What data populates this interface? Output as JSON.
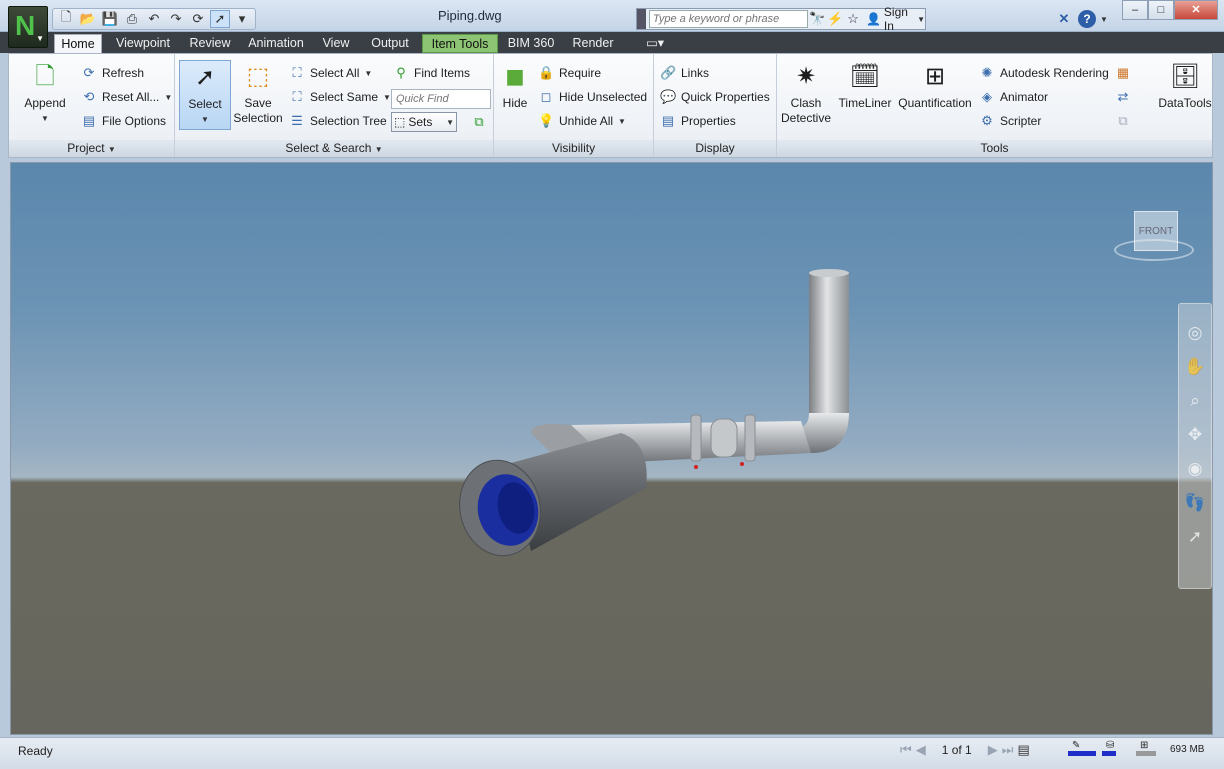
{
  "window": {
    "title": "Piping.dwg",
    "app_logo": "N",
    "controls": [
      "–",
      "□",
      "✕"
    ]
  },
  "quick_access": [
    "new-icon",
    "open-icon",
    "save-icon",
    "print-icon",
    "undo-icon",
    "redo-icon",
    "refresh-icon",
    "select-cursor-icon",
    "customize-icon"
  ],
  "infocenter": {
    "search_placeholder": "Type a keyword or phrase",
    "sign_in": "Sign In"
  },
  "tabs": [
    {
      "label": "Home",
      "active": true
    },
    {
      "label": "Viewpoint"
    },
    {
      "label": "Review"
    },
    {
      "label": "Animation"
    },
    {
      "label": "View"
    },
    {
      "label": "Output"
    },
    {
      "label": "Item Tools",
      "contextual": true
    },
    {
      "label": "BIM 360"
    },
    {
      "label": "Render"
    }
  ],
  "ribbon": {
    "project": {
      "title": "Project",
      "append": "Append",
      "refresh": "Refresh",
      "reset_all": "Reset All...",
      "file_options": "File Options"
    },
    "select_search": {
      "title": "Select & Search",
      "select": "Select",
      "save_selection_1": "Save",
      "save_selection_2": "Selection",
      "select_all": "Select All",
      "select_same": "Select Same",
      "selection_tree": "Selection Tree",
      "find_items": "Find Items",
      "quick_find_placeholder": "Quick Find",
      "sets": "Sets"
    },
    "visibility": {
      "title": "Visibility",
      "hide": "Hide",
      "require": "Require",
      "hide_unselected": "Hide Unselected",
      "unhide_all": "Unhide All"
    },
    "display": {
      "title": "Display",
      "links": "Links",
      "quick_properties": "Quick Properties",
      "properties": "Properties"
    },
    "tools": {
      "title": "Tools",
      "clash_1": "Clash",
      "clash_2": "Detective",
      "timeliner": "TimeLiner",
      "quantification": "Quantification",
      "autodesk_rendering": "Autodesk Rendering",
      "animator": "Animator",
      "scripter": "Scripter",
      "datatools": "DataTools"
    }
  },
  "viewcube": {
    "face": "FRONT"
  },
  "statusbar": {
    "status": "Ready",
    "page": "1 of 1",
    "memory": "693 MB"
  }
}
